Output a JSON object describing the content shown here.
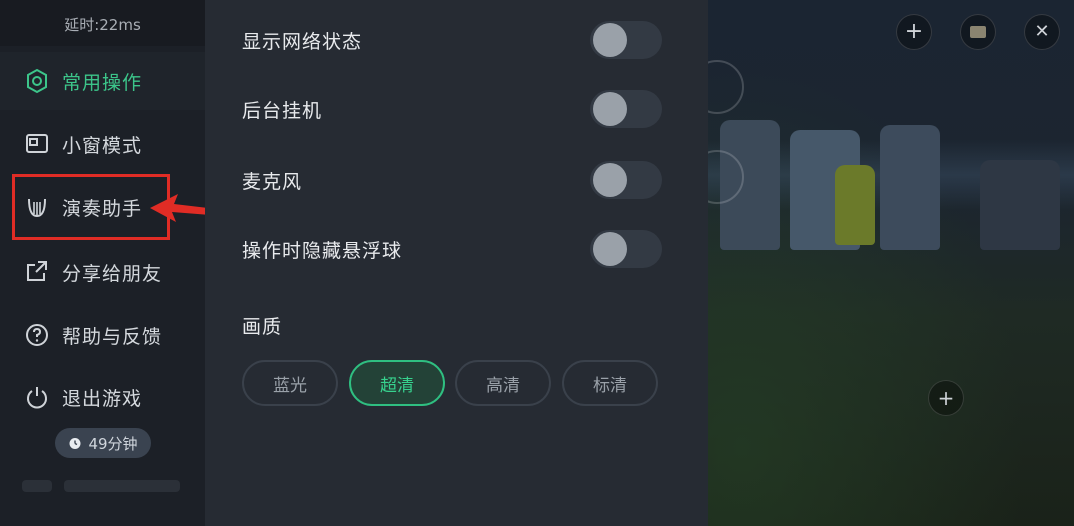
{
  "sidebar": {
    "latency": "延时:22ms",
    "items": [
      {
        "label": "常用操作",
        "icon": "gear-icon",
        "active": true
      },
      {
        "label": "小窗模式",
        "icon": "window-icon",
        "active": false
      },
      {
        "label": "演奏助手",
        "icon": "lyre-icon",
        "active": false
      },
      {
        "label": "分享给朋友",
        "icon": "share-icon",
        "active": false
      },
      {
        "label": "帮助与反馈",
        "icon": "help-icon",
        "active": false
      },
      {
        "label": "退出游戏",
        "icon": "power-icon",
        "active": false
      }
    ],
    "timer": "49分钟"
  },
  "settings": {
    "toggles": [
      {
        "label": "显示网络状态",
        "on": false
      },
      {
        "label": "后台挂机",
        "on": false
      },
      {
        "label": "麦克风",
        "on": false
      },
      {
        "label": "操作时隐藏悬浮球",
        "on": false
      }
    ],
    "quality": {
      "title": "画质",
      "options": [
        "蓝光",
        "超清",
        "高清",
        "标清"
      ],
      "selected": "超清"
    }
  },
  "game": {
    "controls": [
      "plus-icon",
      "map-icon",
      "close-icon"
    ]
  },
  "colors": {
    "accent": "#3cc58a",
    "annotation": "#e02c25",
    "panel": "#262b33",
    "sidebar": "#1c2027"
  }
}
